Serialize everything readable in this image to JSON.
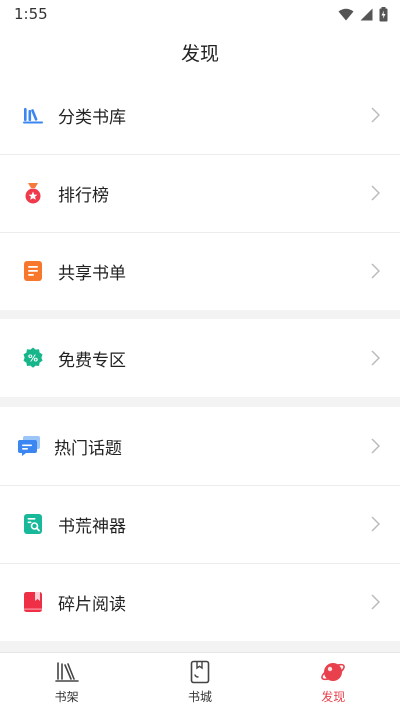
{
  "status_bar": {
    "time": "1:55"
  },
  "header": {
    "title": "发现"
  },
  "groups": [
    {
      "items": [
        {
          "label": "分类书库",
          "icon": "bookshelf-category-icon"
        },
        {
          "label": "排行榜",
          "icon": "medal-icon"
        },
        {
          "label": "共享书单",
          "icon": "list-document-icon"
        }
      ]
    },
    {
      "items": [
        {
          "label": "免费专区",
          "icon": "percent-badge-icon"
        }
      ]
    },
    {
      "items": [
        {
          "label": "热门话题",
          "icon": "chat-bubble-icon"
        },
        {
          "label": "书荒神器",
          "icon": "book-search-icon"
        },
        {
          "label": "碎片阅读",
          "icon": "red-book-icon"
        }
      ]
    }
  ],
  "bottom_nav": {
    "items": [
      {
        "label": "书架",
        "icon": "bookshelf-icon"
      },
      {
        "label": "书城",
        "icon": "bookstore-icon"
      },
      {
        "label": "发现",
        "icon": "discover-planet-icon"
      }
    ],
    "active_index": 2
  },
  "colors": {
    "accent": "#e8404d",
    "background": "#f3f3f3",
    "divider": "#ececec"
  }
}
